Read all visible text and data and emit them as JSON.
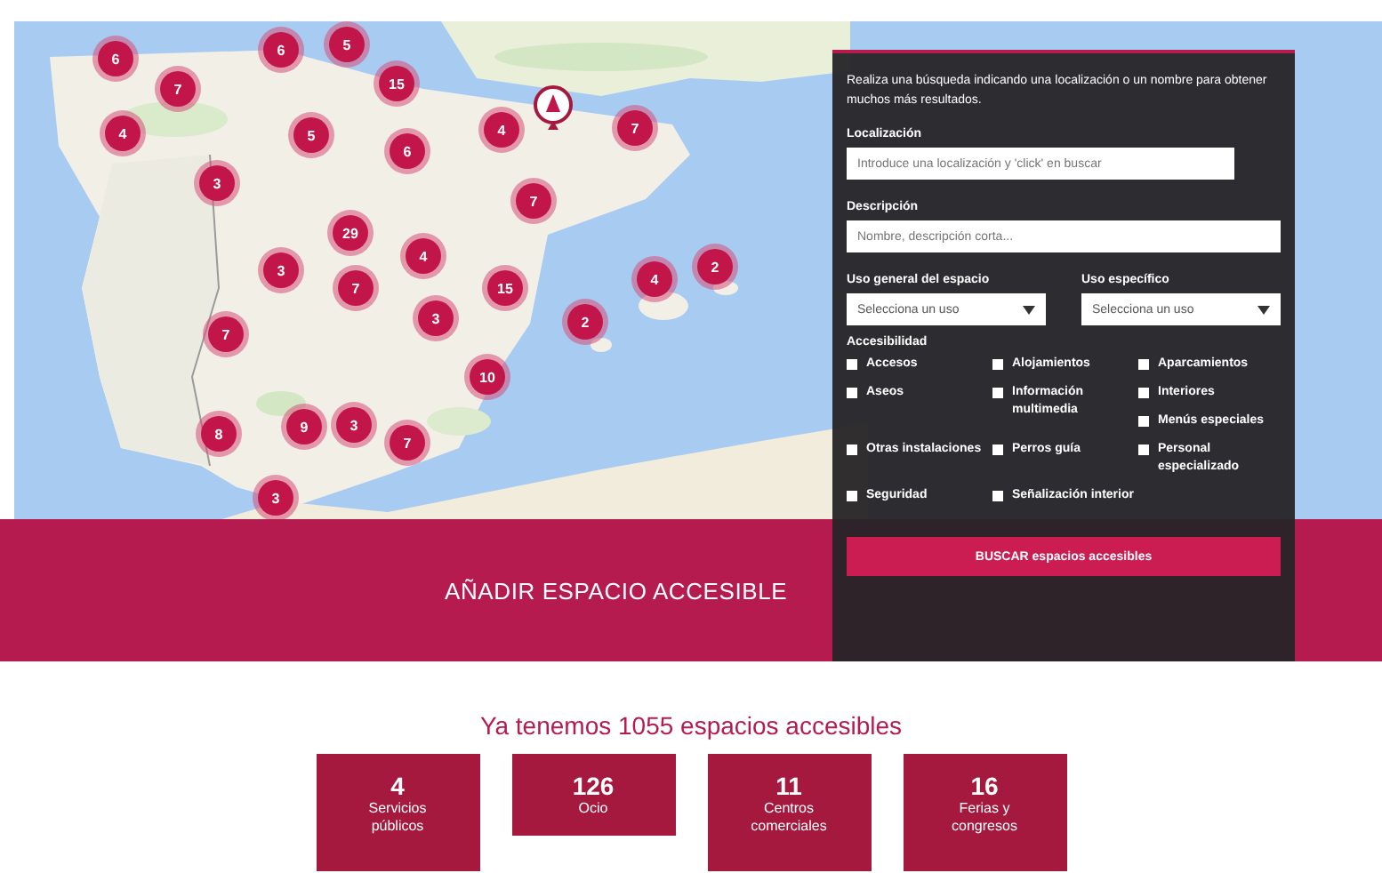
{
  "map": {
    "markers": [
      {
        "label": "6"
      },
      {
        "label": "7"
      },
      {
        "label": "6"
      },
      {
        "label": "5"
      },
      {
        "label": "15"
      },
      {
        "label": "4"
      },
      {
        "label": "5"
      },
      {
        "label": "6"
      },
      {
        "label": "4"
      },
      {
        "label": "7"
      },
      {
        "label": "3"
      },
      {
        "label": "7"
      },
      {
        "label": "29"
      },
      {
        "label": "4"
      },
      {
        "label": "3"
      },
      {
        "label": "7"
      },
      {
        "label": "15"
      },
      {
        "label": "3"
      },
      {
        "label": "4"
      },
      {
        "label": "2"
      },
      {
        "label": "2"
      },
      {
        "label": "7"
      },
      {
        "label": "10"
      },
      {
        "label": "8"
      },
      {
        "label": "9"
      },
      {
        "label": "3"
      },
      {
        "label": "7"
      },
      {
        "label": "3"
      }
    ]
  },
  "add_band": {
    "label": "AÑADIR ESPACIO ACCESIBLE"
  },
  "search_panel": {
    "intro": "Realiza una búsqueda indicando una localización o un nombre para obtener muchos más resultados.",
    "fields": [
      {
        "label": "Localización",
        "placeholder": "Introduce una localización y 'click' en buscar"
      },
      {
        "label": "Descripción",
        "placeholder": "Nombre, descripción corta..."
      }
    ],
    "selects": [
      {
        "label": "Uso general del espacio",
        "value": "Selecciona un uso"
      },
      {
        "label": "Uso específico",
        "value": "Selecciona un uso"
      }
    ],
    "accessibility": {
      "label": "Accesibilidad",
      "rows": [
        [
          [
            {
              "label": "Accesos",
              "checked": false
            }
          ],
          [
            {
              "label": "Alojamientos",
              "checked": false
            }
          ],
          [
            {
              "label": "Aparcamientos",
              "checked": false
            }
          ]
        ],
        [
          [
            {
              "label": "Aseos",
              "checked": false
            }
          ],
          [
            {
              "label": "Información multimedia",
              "checked": false
            }
          ],
          [
            {
              "label": "Interiores",
              "checked": false
            },
            {
              "label": "Menús especiales",
              "checked": false
            }
          ]
        ],
        [
          [
            {
              "label": "Otras instalaciones",
              "checked": false
            }
          ],
          [
            {
              "label": "Perros guía",
              "checked": false
            }
          ],
          [
            {
              "label": "Personal especializado",
              "checked": false
            }
          ]
        ],
        [
          [
            {
              "label": "Seguridad",
              "checked": false
            }
          ],
          [
            {
              "label": "Señalización interior",
              "checked": false
            }
          ],
          []
        ]
      ]
    },
    "button": "BUSCAR espacios accesibles"
  },
  "summary": {
    "heading": "Ya tenemos 1055 espacios accesibles",
    "stats": [
      {
        "count": "4",
        "label": "Servicios públicos"
      },
      {
        "count": "126",
        "label": "Ocio"
      },
      {
        "count": "11",
        "label": "Centros comerciales"
      },
      {
        "count": "16",
        "label": "Ferias y congresos"
      }
    ]
  }
}
